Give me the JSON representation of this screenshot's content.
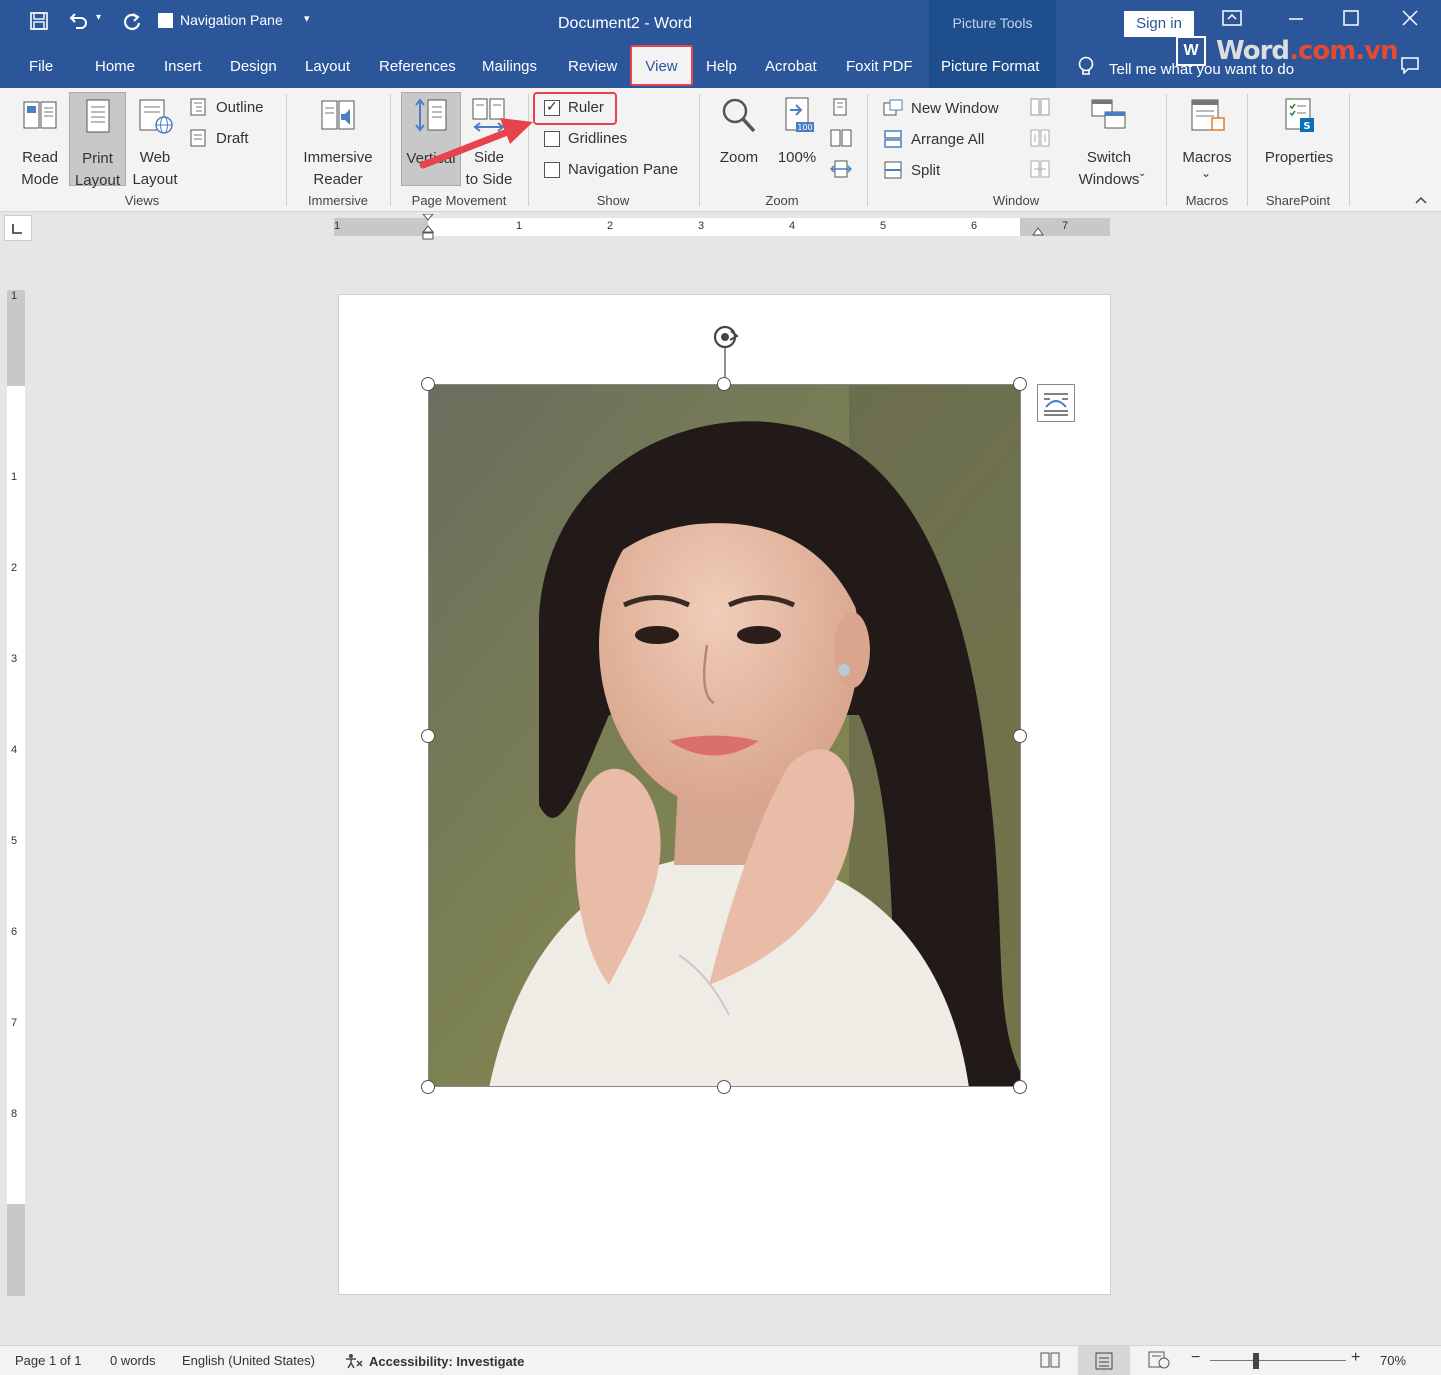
{
  "titlebar": {
    "quick_access_nav_pane": "Navigation Pane",
    "title": "Document2  -  Word",
    "picture_tools": "Picture Tools",
    "sign_in": "Sign in",
    "watermark": {
      "icon": "W",
      "text_a": "Word",
      "text_b": ".com.vn"
    }
  },
  "tabs": [
    "File",
    "Home",
    "Insert",
    "Design",
    "Layout",
    "References",
    "Mailings",
    "Review",
    "View",
    "Help",
    "Acrobat",
    "Foxit PDF",
    "Picture Format"
  ],
  "tell_me": "Tell me what you want to do",
  "ribbon": {
    "views": {
      "read_mode": "Read\nMode",
      "print_layout": "Print\nLayout",
      "web_layout": "Web\nLayout",
      "outline": "Outline",
      "draft": "Draft",
      "group": "Views"
    },
    "immersive": {
      "reader": "Immersive\nReader",
      "group": "Immersive"
    },
    "page_movement": {
      "vertical": "Vertical",
      "side_to_side": "Side\nto Side",
      "group": "Page Movement"
    },
    "show": {
      "ruler": "Ruler",
      "ruler_checked": true,
      "gridlines": "Gridlines",
      "navigation_pane": "Navigation Pane",
      "group": "Show"
    },
    "zoom": {
      "zoom": "Zoom",
      "hundred": "100%",
      "group": "Zoom"
    },
    "window": {
      "new_window": "New Window",
      "arrange_all": "Arrange All",
      "split": "Split",
      "switch_windows": "Switch\nWindows",
      "group": "Window"
    },
    "macros": {
      "macros": "Macros",
      "group": "Macros"
    },
    "sharepoint": {
      "properties": "Properties",
      "group": "SharePoint"
    }
  },
  "ruler": {
    "h_numbers": [
      "1",
      "1",
      "2",
      "3",
      "4",
      "5",
      "6",
      "7"
    ],
    "v_numbers": [
      "1",
      "1",
      "2",
      "3",
      "4",
      "5",
      "6",
      "7",
      "8"
    ]
  },
  "statusbar": {
    "page": "Page 1 of 1",
    "words": "0 words",
    "language": "English (United States)",
    "accessibility": "Accessibility: Investigate",
    "zoom": "70%"
  },
  "colors": {
    "title_blue": "#2b579a",
    "highlight_red": "#e8434c",
    "ribbon_bg": "#f3f3f3"
  }
}
